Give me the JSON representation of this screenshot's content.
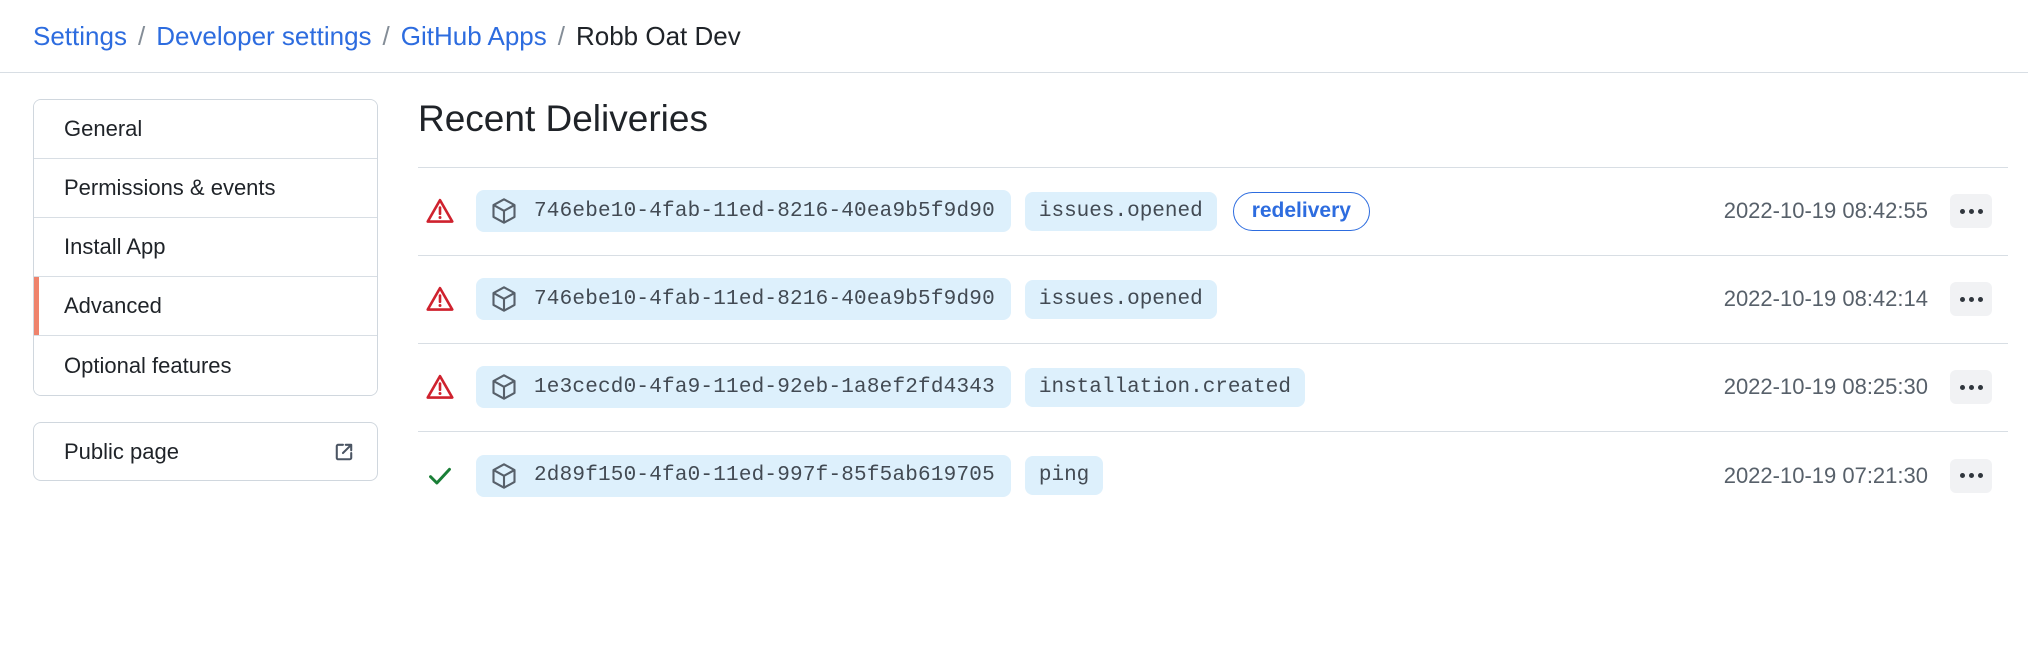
{
  "breadcrumb": {
    "separator": "/",
    "items": [
      {
        "label": "Settings",
        "type": "link"
      },
      {
        "label": "Developer settings",
        "type": "link"
      },
      {
        "label": "GitHub Apps",
        "type": "link"
      },
      {
        "label": "Robb Oat Dev",
        "type": "current"
      }
    ]
  },
  "sidebar": {
    "items": [
      {
        "label": "General",
        "selected": false
      },
      {
        "label": "Permissions & events",
        "selected": false
      },
      {
        "label": "Install App",
        "selected": false
      },
      {
        "label": "Advanced",
        "selected": true
      },
      {
        "label": "Optional features",
        "selected": false
      }
    ],
    "public_page": {
      "label": "Public page",
      "icon": "external-link-icon"
    },
    "selected_indicator_color": "#ef836c"
  },
  "main": {
    "title": "Recent Deliveries",
    "columns": [
      "status",
      "guid",
      "event",
      "badge",
      "timestamp",
      "actions"
    ],
    "deliveries": [
      {
        "status": "failed",
        "status_icon": "warning-triangle-icon",
        "package_icon": "package-icon",
        "guid": "746ebe10-4fab-11ed-8216-40ea9b5f9d90",
        "event": "issues.opened",
        "badge": "redelivery",
        "timestamp": "2022-10-19 08:42:55",
        "menu": "kebab-menu"
      },
      {
        "status": "failed",
        "status_icon": "warning-triangle-icon",
        "package_icon": "package-icon",
        "guid": "746ebe10-4fab-11ed-8216-40ea9b5f9d90",
        "event": "issues.opened",
        "badge": "",
        "timestamp": "2022-10-19 08:42:14",
        "menu": "kebab-menu"
      },
      {
        "status": "failed",
        "status_icon": "warning-triangle-icon",
        "package_icon": "package-icon",
        "guid": "1e3cecd0-4fa9-11ed-92eb-1a8ef2fd4343",
        "event": "installation.created",
        "badge": "",
        "timestamp": "2022-10-19 08:25:30",
        "menu": "kebab-menu"
      },
      {
        "status": "success",
        "status_icon": "check-icon",
        "package_icon": "package-icon",
        "guid": "2d89f150-4fa0-11ed-997f-85f5ab619705",
        "event": "ping",
        "badge": "",
        "timestamp": "2022-10-19 07:21:30",
        "menu": "kebab-menu"
      }
    ]
  },
  "colors": {
    "link": "#2d6cdf",
    "failed": "#cf222e",
    "success": "#1a7f37",
    "chip_background": "#ddf0fc",
    "border": "#d8dee4"
  }
}
